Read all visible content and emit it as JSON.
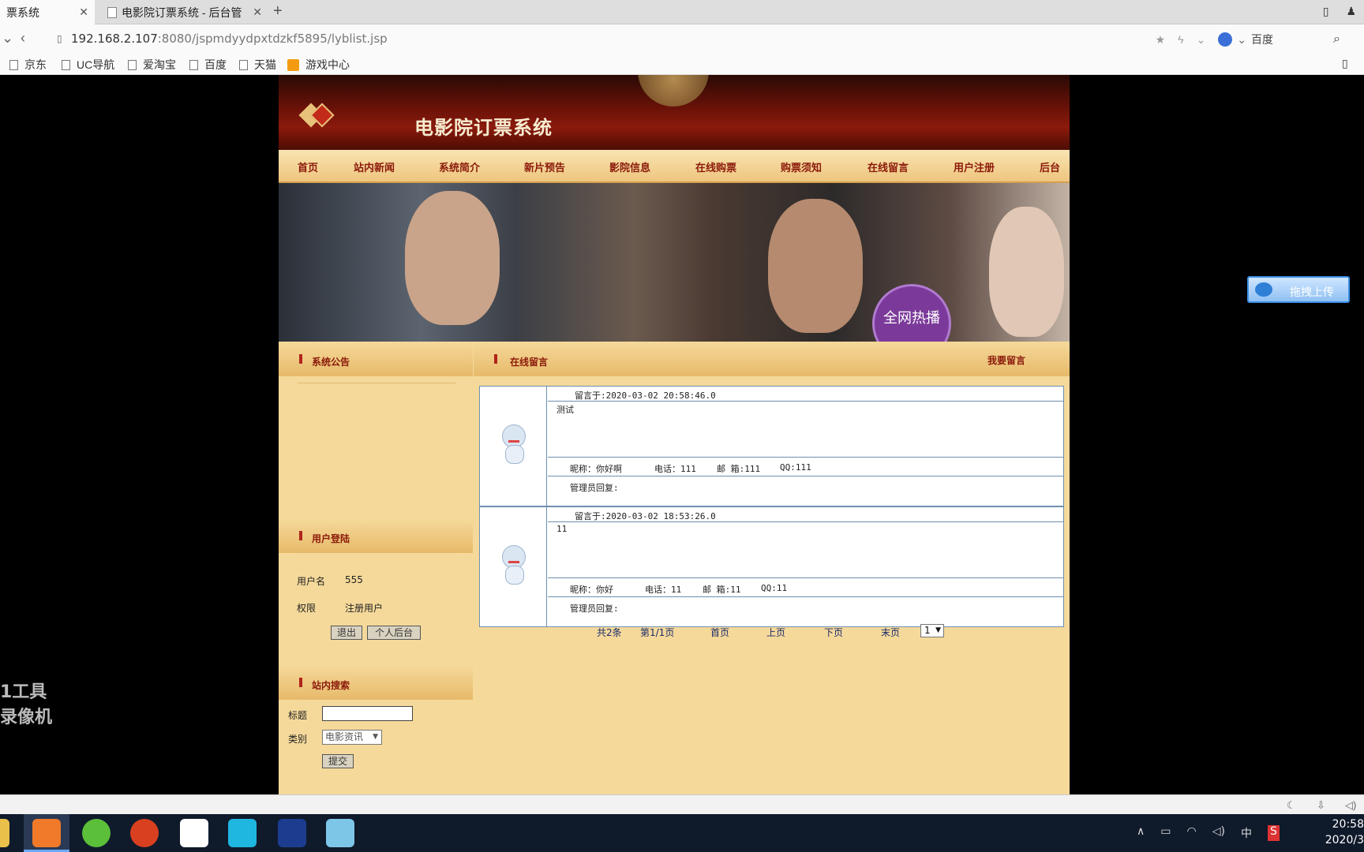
{
  "browser": {
    "tabs": [
      {
        "label": "票系统",
        "active": true
      },
      {
        "label": "电影院订票系统 - 后台管",
        "active": false
      }
    ],
    "new_tab": "+",
    "url_host": "192.168.2.107",
    "url_rest": ":8080/jspmdyydpxtdzkf5895/lyblist.jsp",
    "search_engine": "百度",
    "bookmarks": [
      "京东",
      "UC导航",
      "爱淘宝",
      "百度",
      "天猫",
      "游戏中心"
    ]
  },
  "site": {
    "title": "电影院订票系统",
    "nav": [
      "首页",
      "站内新闻",
      "系统简介",
      "新片预告",
      "影院信息",
      "在线购票",
      "购票须知",
      "在线留言",
      "用户注册",
      "后台"
    ],
    "banner_stamp": "全网热播"
  },
  "sidebar": {
    "notice_title": "系统公告",
    "login_title": "用户登陆",
    "username_label": "用户名",
    "username_value": "555",
    "role_label": "权限",
    "role_value": "注册用户",
    "logout_button": "退出",
    "backend_button": "个人后台",
    "search_title": "站内搜索",
    "search_title_label": "标题",
    "search_title_value": "",
    "category_label": "类别",
    "category_value": "电影资讯",
    "submit_button": "提交"
  },
  "main": {
    "title": "在线留言",
    "action": "我要留言",
    "messages": [
      {
        "time": "留言于:2020-03-02 20:58:46.0",
        "content": "测试",
        "nickname": "昵称：你好啊",
        "phone": "电话：111",
        "email": "邮 箱:111",
        "qq": "QQ:111",
        "reply": "管理员回复:"
      },
      {
        "time": "留言于:2020-03-02 18:53:26.0",
        "content": "11",
        "nickname": "昵称：你好",
        "phone": "电话：11",
        "email": "邮 箱:11",
        "qq": "QQ:11",
        "reply": "管理员回复:"
      }
    ],
    "pager": {
      "total": "共2条",
      "page": "第1/1页",
      "first": "首页",
      "prev": "上页",
      "next": "下页",
      "last": "末页",
      "select": "1"
    }
  },
  "overlay": {
    "upload_button": "拖拽上传",
    "watermark_line1": "1工具",
    "watermark_line2": "录像机"
  },
  "taskbar": {
    "ime": "中",
    "time": "20:58",
    "date": "2020/3"
  }
}
